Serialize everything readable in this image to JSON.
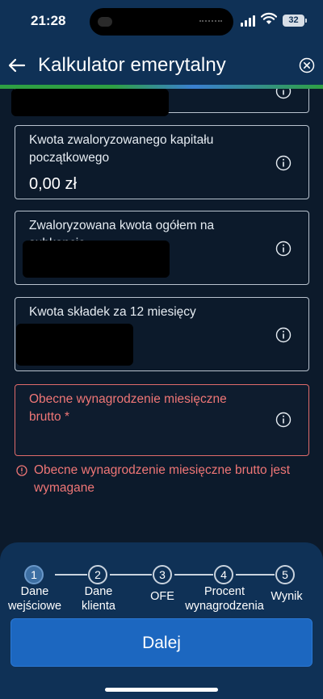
{
  "status_bar": {
    "time": "21:28",
    "battery": "32"
  },
  "header": {
    "title": "Kalkulator emerytalny"
  },
  "fields": [
    {
      "label": "Kwota zwaloryzowanego kapitału początkowego",
      "value": "0,00 zł"
    },
    {
      "label": "Zwaloryzowana kwota ogółem na subkoncie"
    },
    {
      "label": "Kwota składek za 12 miesięcy kalendarzowych"
    },
    {
      "label": "Obecne wynagrodzenie miesięczne brutto *",
      "value": ""
    }
  ],
  "error_message": "Obecne wynagrodzenie miesięczne brutto jest wymagane",
  "colors": {
    "accent": "#1c67c0",
    "error": "#ef7676",
    "header": "#0f3156",
    "background": "#0c1a2b"
  },
  "steps": [
    {
      "number": "1",
      "label": "Dane wejściowe",
      "active": true
    },
    {
      "number": "2",
      "label": "Dane klienta"
    },
    {
      "number": "3",
      "label": "OFE"
    },
    {
      "number": "4",
      "label": "Procent wynagrodzenia"
    },
    {
      "number": "5",
      "label": "Wynik"
    }
  ],
  "next_button": "Dalej"
}
